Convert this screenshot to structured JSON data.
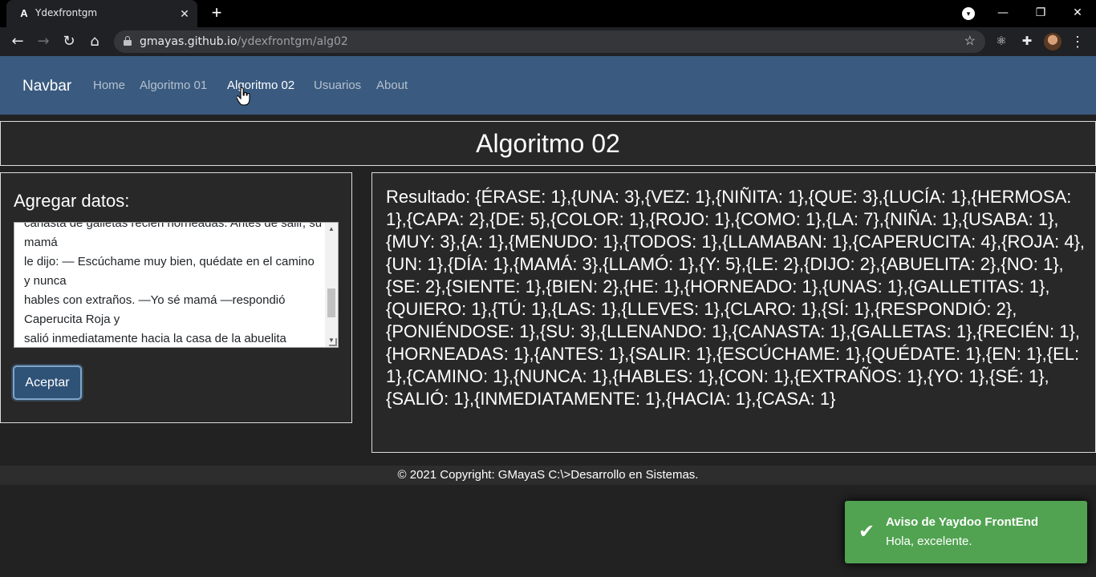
{
  "browser": {
    "tab_title": "Ydexfrontgm",
    "tab_favicon": "A",
    "tab_close": "✕",
    "new_tab": "+",
    "url_host": "gmayas.github.io",
    "url_path": "/ydexfrontgm/alg02"
  },
  "navbar": {
    "brand": "Navbar",
    "links": [
      "Home",
      "Algoritmo 01",
      "Algoritmo 02",
      "Usuarios",
      "About"
    ]
  },
  "page": {
    "title": "Algoritmo 02"
  },
  "input": {
    "label": "Agregar datos:",
    "textarea_value": "canasta de galletas recién horneadas. Antes de salir, su mamá\nle dijo: — Escúchame muy bien, quédate en el camino y nunca\nhables con extraños. —Yo sé mamá —respondió Caperucita Roja y\nsalió inmediatamente hacia la casa de la abuelita",
    "button_label": "Aceptar"
  },
  "result": {
    "text": "Resultado: {ÉRASE: 1},{UNA: 3},{VEZ: 1},{NIÑITA: 1},{QUE: 3},{LUCÍA: 1},{HERMOSA: 1},{CAPA: 2},{DE: 5},{COLOR: 1},{ROJO: 1},{COMO: 1},{LA: 7},{NIÑA: 1},{USABA: 1},{MUY: 3},{A: 1},{MENUDO: 1},{TODOS: 1},{LLAMABAN: 1},{CAPERUCITA: 4},{ROJA: 4},{UN: 1},{DÍA: 1},{MAMÁ: 3},{LLAMÓ: 1},{Y: 5},{LE: 2},{DIJO: 2},{ABUELITA: 2},{NO: 1},{SE: 2},{SIENTE: 1},{BIEN: 2},{HE: 1},{HORNEADO: 1},{UNAS: 1},{GALLETITAS: 1},{QUIERO: 1},{TÚ: 1},{LAS: 1},{LLEVES: 1},{CLARO: 1},{SÍ: 1},{RESPONDIÓ: 2},{PONIÉNDOSE: 1},{SU: 3},{LLENANDO: 1},{CANASTA: 1},{GALLETAS: 1},{RECIÉN: 1},{HORNEADAS: 1},{ANTES: 1},{SALIR: 1},{ESCÚCHAME: 1},{QUÉDATE: 1},{EN: 1},{EL: 1},{CAMINO: 1},{NUNCA: 1},{HABLES: 1},{CON: 1},{EXTRAÑOS: 1},{YO: 1},{SÉ: 1},{SALIÓ: 1},{INMEDIATAMENTE: 1},{HACIA: 1},{CASA: 1}"
  },
  "footer": {
    "text": "© 2021 Copyright: GMayaS C:\\>Desarrollo en Sistemas."
  },
  "toast": {
    "title": "Aviso de Yaydoo FrontEnd",
    "message": "Hola, excelente.",
    "color": "#51a351"
  },
  "colors": {
    "navbar": "#3a5a7f",
    "background": "#222222"
  }
}
